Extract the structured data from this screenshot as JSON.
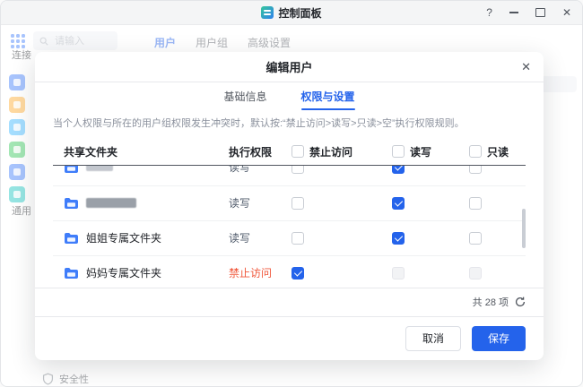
{
  "colors": {
    "accent": "#2463eb",
    "danger": "#f0583c",
    "checkbox_checked": "#2463eb"
  },
  "window": {
    "title": "控制面板",
    "controls": {
      "help": "?",
      "close": "✕"
    }
  },
  "toolbar": {
    "search_placeholder": "请输入",
    "tabs": [
      {
        "label": "用户",
        "active": true
      },
      {
        "label": "用户组",
        "active": false
      },
      {
        "label": "高级设置",
        "active": false
      }
    ]
  },
  "sidebar": {
    "section_labels": [
      "连接",
      "通用"
    ],
    "bottom_item": "安全性",
    "rail_items": [
      {
        "name": "user-icon",
        "color": "#3f7dfa"
      },
      {
        "name": "folder-icon",
        "color": "#ffab2e"
      },
      {
        "name": "sync-icon",
        "color": "#38b6ff"
      },
      {
        "name": "backup-icon",
        "color": "#34c759"
      },
      {
        "name": "device-icon",
        "color": "#3f7dfa"
      },
      {
        "name": "network-icon",
        "color": "#18c5c0"
      }
    ]
  },
  "modal": {
    "title": "编辑用户",
    "close": "✕",
    "tabs": [
      {
        "label": "基础信息",
        "active": false
      },
      {
        "label": "权限与设置",
        "active": true
      }
    ],
    "notice": "当个人权限与所在的用户组权限发生冲突时，默认按:“禁止访问>读写>只读>空”执行权限规则。",
    "table": {
      "headers": {
        "folder": "共享文件夹",
        "perm": "执行权限",
        "deny": "禁止访问",
        "rw": "读写",
        "ro": "只读"
      },
      "rows": [
        {
          "name": "",
          "redacted": true,
          "partial": true,
          "permission": "读写",
          "deny": false,
          "rw": true,
          "ro": false
        },
        {
          "name": "",
          "redacted": true,
          "permission": "读写",
          "deny": false,
          "rw": true,
          "ro": false
        },
        {
          "name": "姐姐专属文件夹",
          "permission": "读写",
          "deny": false,
          "rw": true,
          "ro": false
        },
        {
          "name": "妈妈专属文件夹",
          "permission": "禁止访问",
          "permission_red": true,
          "deny": true,
          "rw": false,
          "ro": false,
          "others_disabled": true
        }
      ]
    },
    "footer": {
      "count": "共 28 项",
      "cancel": "取消",
      "save": "保存"
    }
  }
}
